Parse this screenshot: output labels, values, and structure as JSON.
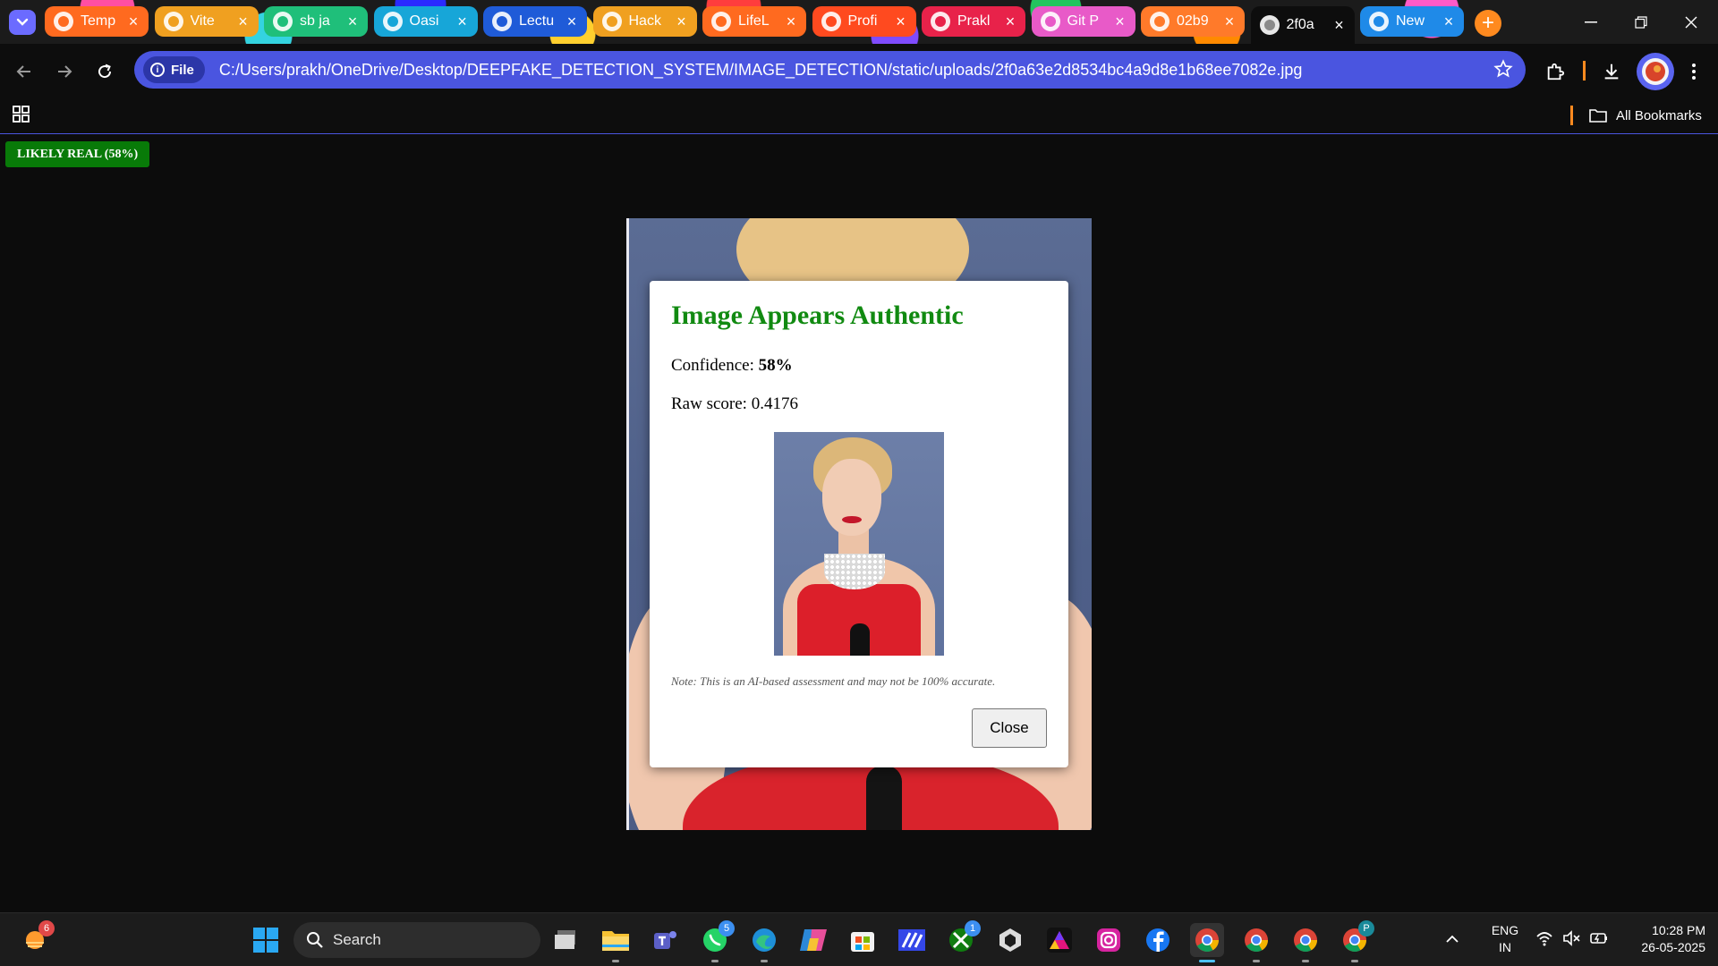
{
  "browser": {
    "tabs": [
      {
        "title": "Temp",
        "color": "#ff6a1f",
        "icon": "tinybird-icon",
        "active": false
      },
      {
        "title": "Vite",
        "color": "#f0a020",
        "icon": "vite-icon",
        "active": false
      },
      {
        "title": "sb ja",
        "color": "#1fbf7a",
        "icon": "google-icon",
        "active": false
      },
      {
        "title": "Oasi",
        "color": "#17a6d8",
        "icon": "oasis-icon",
        "active": false
      },
      {
        "title": "Lectu",
        "color": "#1f5bd8",
        "icon": "youtube-icon",
        "active": false
      },
      {
        "title": "Hack",
        "color": "#f0a020",
        "icon": "hackathon-heart-icon",
        "active": false
      },
      {
        "title": "LifeL",
        "color": "#ff6a1f",
        "icon": "list-icon",
        "active": false
      },
      {
        "title": "Profi",
        "color": "#ff4a1f",
        "icon": "firebase-icon",
        "active": false
      },
      {
        "title": "Prakl",
        "color": "#e8224a",
        "icon": "github-icon",
        "active": false
      },
      {
        "title": "Git P",
        "color": "#e85ac8",
        "icon": "openai-icon",
        "active": false
      },
      {
        "title": "02b9",
        "color": "#ff7a2a",
        "icon": "globe-icon",
        "active": false
      },
      {
        "title": "2f0a",
        "color": "#0d0d0d",
        "icon": "globe-icon",
        "active": true
      },
      {
        "title": "New",
        "color": "#1f8ae8",
        "icon": "chrome-icon",
        "active": false
      }
    ],
    "address": {
      "scheme_chip": "File",
      "url": "C:/Users/prakh/OneDrive/Desktop/DEEPFAKE_DETECTION_SYSTEM/IMAGE_DETECTION/static/uploads/2f0a63e2d8534bc4a9d8e1b68ee7082e.jpg"
    },
    "bookmarks": {
      "all_label": "All Bookmarks"
    },
    "accent_color": "#4a55e0"
  },
  "page": {
    "badge_label": "LIKELY REAL (58%)",
    "badge_color": "#087a08",
    "modal": {
      "title": "Image Appears Authentic",
      "title_color": "#118a11",
      "confidence_label": "Confidence:",
      "confidence_value": "58%",
      "raw_label": "Raw score:",
      "raw_value": "0.4176",
      "note": "Note: This is an AI-based assessment and may not be 100% accurate.",
      "close_label": "Close"
    }
  },
  "taskbar": {
    "search_placeholder": "Search",
    "weather_badge": "6",
    "whatsapp_badge": "5",
    "xbox_badge": "1",
    "chrome_profile_badge": "P",
    "apps": [
      "weather-icon",
      "windows-start-icon",
      "task-view-icon",
      "file-explorer-icon",
      "teams-icon",
      "whatsapp-icon",
      "edge-icon",
      "copilot-icon",
      "microsoft-store-icon",
      "vscode-like-icon",
      "xbox-icon",
      "unity-icon",
      "affinity-icon",
      "instagram-icon",
      "facebook-icon",
      "chrome-icon",
      "chrome-icon",
      "chrome-icon",
      "chrome-icon"
    ],
    "tray": {
      "lang_line1": "ENG",
      "lang_line2": "IN",
      "time": "10:28 PM",
      "date": "26-05-2025"
    }
  }
}
